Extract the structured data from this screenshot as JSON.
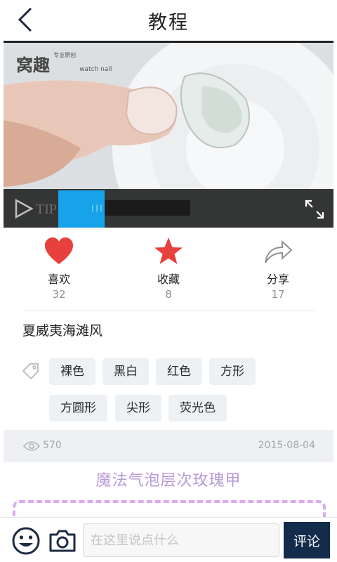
{
  "header": {
    "title": "教程"
  },
  "video": {
    "watermark_brand": "窝趣",
    "watermark_tagline": "专业原创",
    "watermark_en": "watch nail",
    "tip_text": "TIP",
    "progress": 0.35,
    "accent_color": "#16a3ea"
  },
  "actions": [
    {
      "label": "喜欢",
      "count": "32",
      "icon": "heart-icon"
    },
    {
      "label": "收藏",
      "count": "8",
      "icon": "star-icon"
    },
    {
      "label": "分享",
      "count": "17",
      "icon": "share-icon"
    }
  ],
  "post": {
    "title": "夏威夷海滩风",
    "tags": [
      "裸色",
      "黑白",
      "红色",
      "方形",
      "方圆形",
      "尖形",
      "荧光色"
    ]
  },
  "meta": {
    "views": "570",
    "date": "2015-08-04"
  },
  "content": {
    "subtitle": "魔法气泡层次玫瑰甲"
  },
  "comment": {
    "placeholder": "在这里说点什么",
    "submit_label": "评论"
  },
  "colors": {
    "heart": "#e8403c",
    "star": "#e8403c",
    "brand_dark": "#142c4c",
    "subtitle": "#b69bd6"
  }
}
